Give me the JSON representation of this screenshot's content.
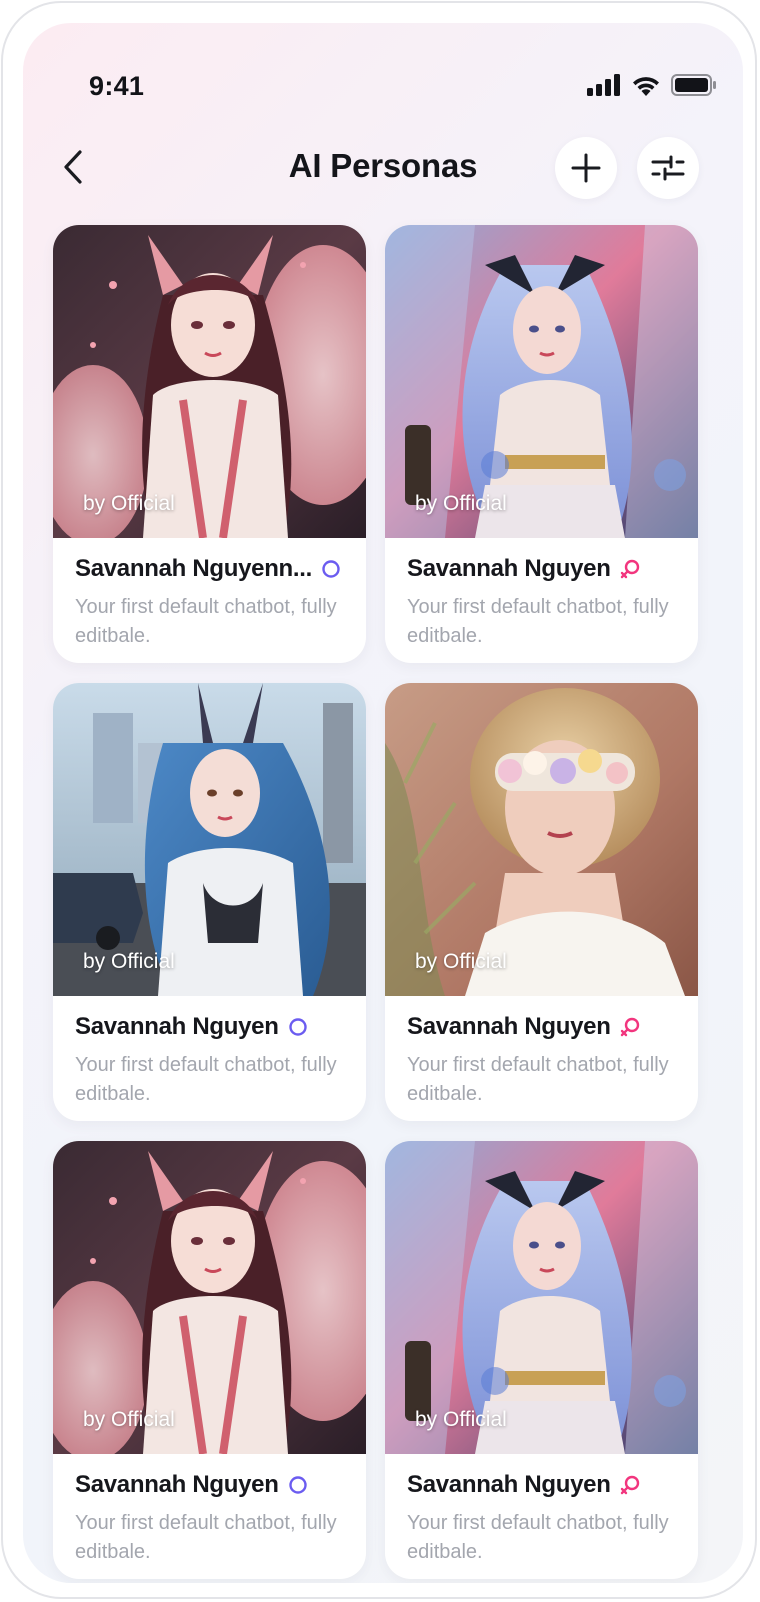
{
  "status_bar": {
    "time": "9:41"
  },
  "header": {
    "title": "AI Personas"
  },
  "colors": {
    "neutral_gender": "#6b5cf0",
    "female_gender": "#f2357e"
  },
  "cards": [
    {
      "byline": "by Official",
      "name": "Savannah Nguyenn...",
      "gender_icon": "neutral-circle-icon",
      "description": "Your first default chatbot, fully editbale.",
      "image": "fox-girl-portrait"
    },
    {
      "byline": "by Official",
      "name": "Savannah Nguyen",
      "gender_icon": "female-symbol-icon",
      "description": "Your first default chatbot, fully editbale.",
      "image": "fantasy-horned-girl-portrait"
    },
    {
      "byline": "by Official",
      "name": "Savannah Nguyen",
      "gender_icon": "neutral-circle-icon",
      "description": "Your first default chatbot, fully editbale.",
      "image": "bunny-girl-street-portrait"
    },
    {
      "byline": "by Official",
      "name": "Savannah Nguyen",
      "gender_icon": "female-symbol-icon",
      "description": "Your first default chatbot, fully editbale.",
      "image": "flower-blindfold-portrait"
    },
    {
      "byline": "by Official",
      "name": "Savannah Nguyen",
      "gender_icon": "neutral-circle-icon",
      "description": "Your first default chatbot, fully editbale.",
      "image": "fox-girl-portrait"
    },
    {
      "byline": "by Official",
      "name": "Savannah Nguyen",
      "gender_icon": "female-symbol-icon",
      "description": "Your first default chatbot, fully editbale.",
      "image": "fantasy-horned-girl-portrait"
    }
  ]
}
